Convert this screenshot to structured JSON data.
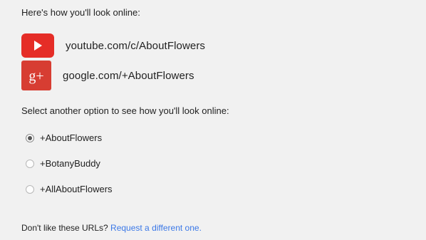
{
  "intro_text": "Here's how you'll look online:",
  "urls": {
    "youtube": {
      "icon": "youtube-play-icon",
      "url": "youtube.com/c/AboutFlowers",
      "color": "#e52d27"
    },
    "google_plus": {
      "icon": "google-plus-icon",
      "url": "google.com/+AboutFlowers",
      "color": "#d73d32",
      "glyph": "g+"
    }
  },
  "select_label": "Select another option to see how you'll look online:",
  "options": [
    {
      "label": "+AboutFlowers",
      "selected": true
    },
    {
      "label": "+BotanyBuddy",
      "selected": false
    },
    {
      "label": "+AllAboutFlowers",
      "selected": false
    }
  ],
  "footer": {
    "question": "Don't like these URLs?",
    "link": "Request a different one.",
    "link_color": "#3b78e7"
  }
}
